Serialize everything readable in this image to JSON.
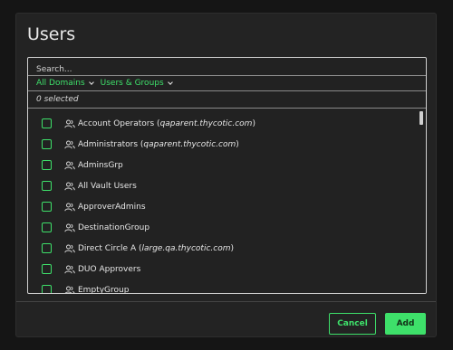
{
  "modal": {
    "title": "Users"
  },
  "search": {
    "placeholder": "Search..."
  },
  "filters": {
    "domains": "All Domains",
    "types": "Users & Groups"
  },
  "selection": {
    "count_text": "0 selected"
  },
  "items": [
    {
      "name": "Account Operators",
      "domain": "qaparent.thycotic.com"
    },
    {
      "name": "Administrators",
      "domain": "qaparent.thycotic.com"
    },
    {
      "name": "AdminsGrp",
      "domain": ""
    },
    {
      "name": "All Vault Users",
      "domain": ""
    },
    {
      "name": "ApproverAdmins",
      "domain": ""
    },
    {
      "name": "DestinationGroup",
      "domain": ""
    },
    {
      "name": "Direct Circle A",
      "domain": "large.qa.thycotic.com"
    },
    {
      "name": "DUO Approvers",
      "domain": ""
    },
    {
      "name": "EmptyGroup",
      "domain": ""
    }
  ],
  "buttons": {
    "cancel": "Cancel",
    "add": "Add"
  },
  "colors": {
    "accent": "#3ee06a",
    "surface": "#232323"
  },
  "icons": {
    "row": "group-icon",
    "dropdown": "chevron-down-icon"
  }
}
